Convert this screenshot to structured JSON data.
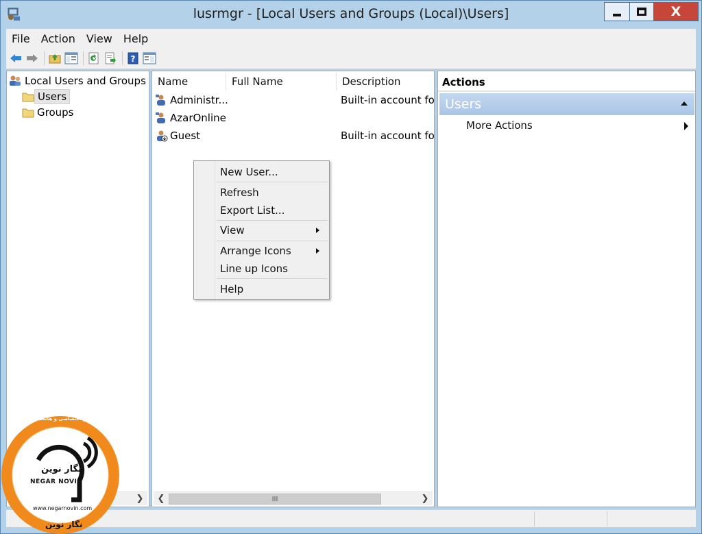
{
  "window": {
    "title": "lusrmgr - [Local Users and Groups (Local)\\Users]",
    "close_glyph": "X"
  },
  "menubar": {
    "items": [
      "File",
      "Action",
      "View",
      "Help"
    ]
  },
  "toolbar": {
    "icons": [
      "back-icon",
      "forward-icon",
      "up-folder-icon",
      "show-hide-tree-icon",
      "refresh-icon",
      "export-list-icon",
      "help-icon",
      "show-hide-action-pane-icon"
    ]
  },
  "tree": {
    "root": "Local Users and Groups (L",
    "items": [
      "Users",
      "Groups"
    ],
    "selected": "Users"
  },
  "list": {
    "columns": [
      "Name",
      "Full Name",
      "Description"
    ],
    "rows": [
      {
        "name": "Administr...",
        "full_name": "",
        "description": "Built-in account for"
      },
      {
        "name": "AzarOnline",
        "full_name": "",
        "description": ""
      },
      {
        "name": "Guest",
        "full_name": "",
        "description": "Built-in account for"
      }
    ],
    "scroll_grip": "III"
  },
  "context_menu": {
    "items": [
      "New User...",
      "Refresh",
      "Export List...",
      "View",
      "Arrange Icons",
      "Line up Icons",
      "Help"
    ]
  },
  "actions": {
    "title": "Actions",
    "group": "Users",
    "item": "More Actions"
  },
  "watermark": {
    "brand_fa": "نگار نوین",
    "brand_en": "NEGAR NOVIN",
    "url": "www.negarnovin.com",
    "tagline_fa": "سرور مجازی و اختصاصی و هاستینگ",
    "footer_fa": "نگار نوین"
  },
  "colors": {
    "title_bg": "#b3d1e8",
    "close_btn": "#c7463a",
    "actions_group_bg": "#aac6e6",
    "badge_orange": "#f08a1c"
  }
}
